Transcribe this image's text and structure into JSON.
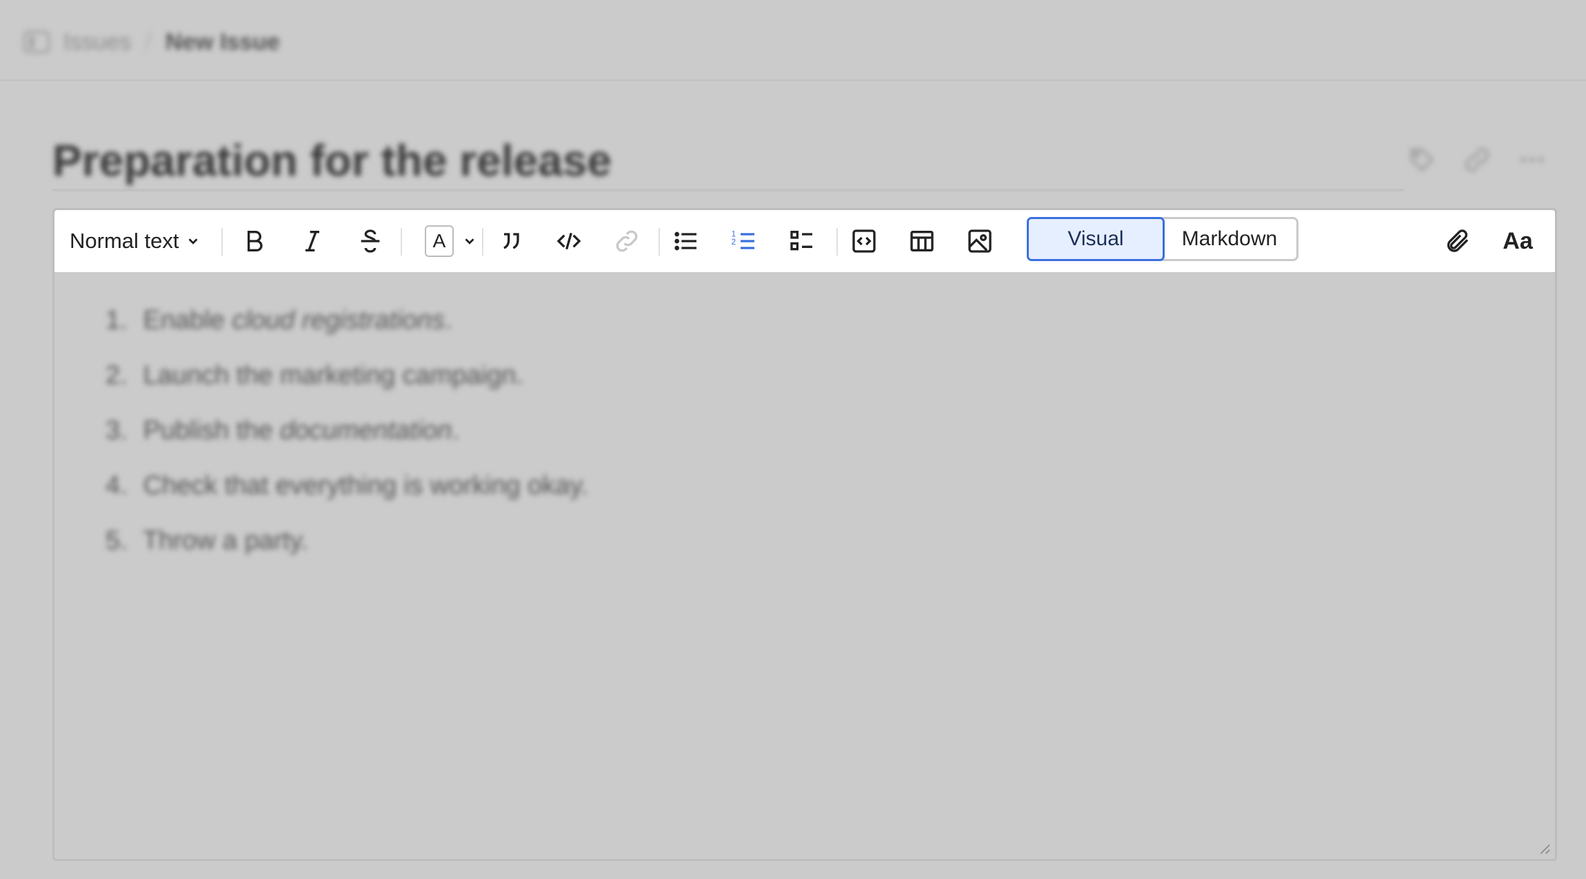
{
  "breadcrumb": {
    "items": [
      "Issues",
      "/",
      "New Issue"
    ]
  },
  "issue": {
    "title": "Preparation for the release"
  },
  "toolbar": {
    "text_style": "Normal text",
    "modes": [
      "Visual",
      "Markdown"
    ],
    "active_mode": "Visual",
    "font_size_label": "Aa",
    "text_color_label": "A",
    "active_tool": "ordered-list",
    "accent_color": "#3a6fe0"
  },
  "content": {
    "list": [
      {
        "num": "1.",
        "text_a": "Enable ",
        "text_italic": "cloud registrations",
        "text_b": "."
      },
      {
        "num": "2.",
        "text_a": "Launch the marketing campaign.",
        "text_italic": "",
        "text_b": ""
      },
      {
        "num": "3.",
        "text_a": "Publish the ",
        "text_italic": "documentation",
        "text_b": "."
      },
      {
        "num": "4.",
        "text_a": "Check that everything is working okay.",
        "text_italic": "",
        "text_b": ""
      },
      {
        "num": "5.",
        "text_a": "Throw a party.",
        "text_italic": "",
        "text_b": ""
      }
    ]
  }
}
